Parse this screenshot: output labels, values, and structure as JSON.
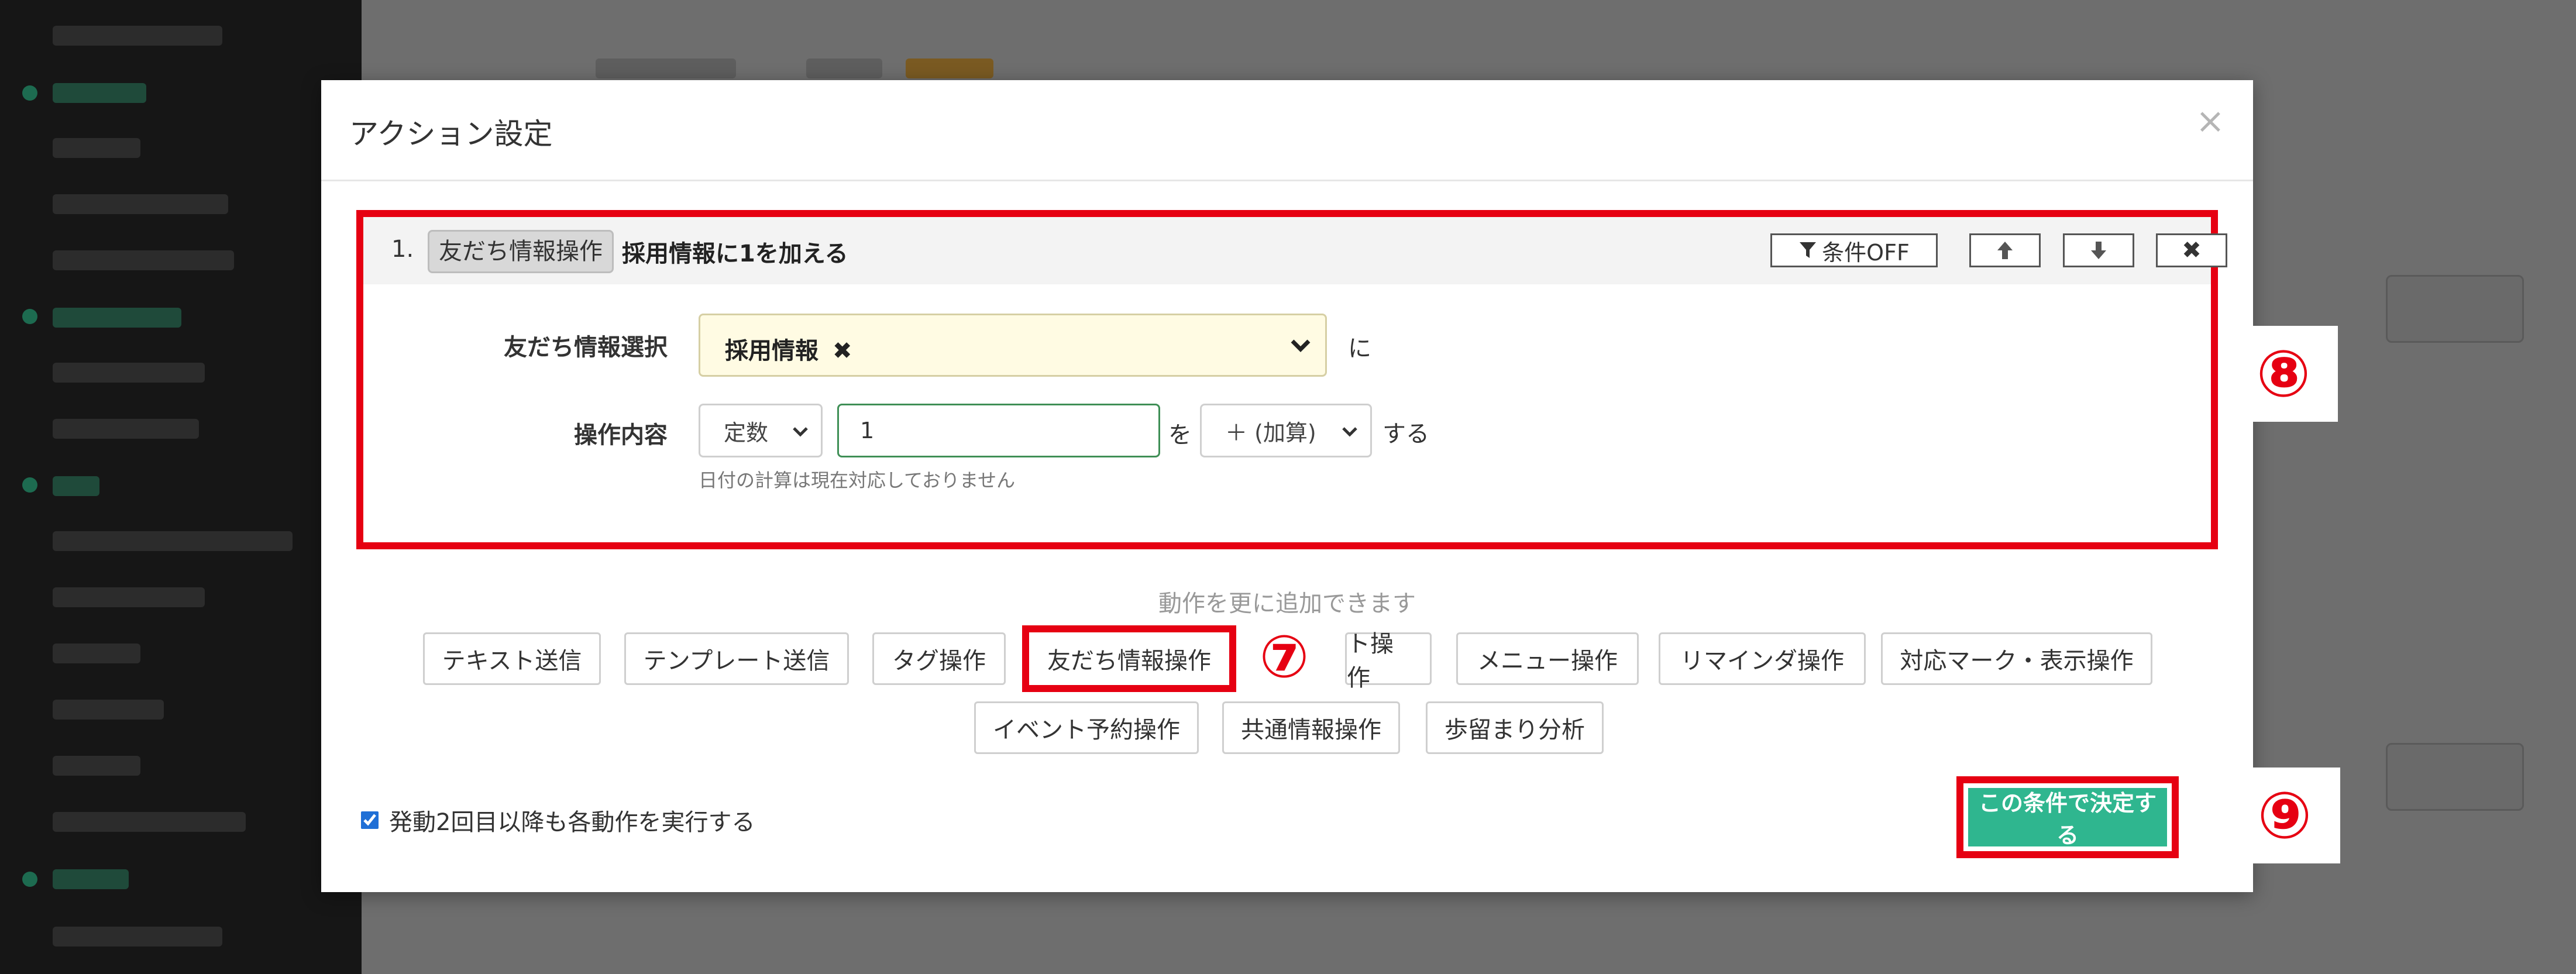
{
  "modal": {
    "title": "アクション設定",
    "close_glyph": "×"
  },
  "action": {
    "index": "1.",
    "type_label": "友だち情報操作",
    "summary": "採用情報に1を加える",
    "buttons": {
      "condition_off": "条件OFF",
      "up_glyph": "🡅",
      "down_glyph": "🡇",
      "delete_glyph": "✖"
    },
    "field_select_label": "友だち情報選択",
    "selected_field": "採用情報",
    "chip_remove_glyph": "✖",
    "select_suffix": "に",
    "operation_label": "操作内容",
    "value_type": "定数",
    "value": "1",
    "particle_wo": "を",
    "operator": "＋ (加算)",
    "suffix_suru": "する",
    "help_text": "日付の計算は現在対応しておりません"
  },
  "add_section": {
    "hint": "動作を更に追加できます",
    "buttons_row1": [
      "テキスト送信",
      "テンプレート送信",
      "タグ操作",
      "友だち情報操作",
      "ト操作",
      "メニュー操作",
      "リマインダ操作",
      "対応マーク・表示操作"
    ],
    "buttons_row2": [
      "イベント予約操作",
      "共通情報操作",
      "歩留まり分析"
    ]
  },
  "footer": {
    "repeat_checkbox_label": "発動2回目以降も各動作を実行する",
    "repeat_checked": true,
    "submit_label": "この条件で決定する"
  },
  "callouts": {
    "seven": "⑦",
    "eight": "⑧",
    "nine": "⑨"
  },
  "icons": {
    "filter": "filter-icon",
    "arrow_up": "arrow-up-icon",
    "arrow_down": "arrow-down-icon",
    "delete": "delete-icon",
    "chevron": "chevron-down-icon"
  },
  "colors": {
    "accent_red": "#e60012",
    "submit_green": "#2fb68f",
    "selected_field_bg": "#fffbe3",
    "input_border_green": "#3f8f56"
  }
}
